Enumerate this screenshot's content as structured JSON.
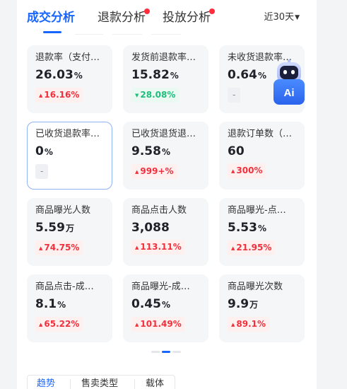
{
  "tabs": [
    {
      "label": "成交分析",
      "active": true,
      "dot": false
    },
    {
      "label": "退款分析",
      "active": false,
      "dot": true
    },
    {
      "label": "投放分析",
      "active": false,
      "dot": true
    }
  ],
  "date_range": {
    "label": "近30天",
    "icon": "caret-down-icon"
  },
  "metrics": [
    {
      "title": "退款率（支付…",
      "value": "26.03",
      "unit": "%",
      "change": "16.16%",
      "trend": "up"
    },
    {
      "title": "发货前退款率…",
      "value": "15.82",
      "unit": "%",
      "change": "28.08%",
      "trend": "down"
    },
    {
      "title": "未收货退款率…",
      "value": "0.64",
      "unit": "%",
      "change": "-",
      "trend": "flat"
    },
    {
      "title": "已收货退款率…",
      "value": "0",
      "unit": "%",
      "change": "-",
      "trend": "flat",
      "selected": true
    },
    {
      "title": "已收货退货退…",
      "value": "9.58",
      "unit": "%",
      "change": "999+%",
      "trend": "up"
    },
    {
      "title": "退款订单数（…",
      "value": "60",
      "unit": "",
      "change": "300%",
      "trend": "up"
    },
    {
      "title": "商品曝光人数",
      "value": "5.59",
      "unit": "万",
      "change": "74.75%",
      "trend": "up"
    },
    {
      "title": "商品点击人数",
      "value": "3,088",
      "unit": "",
      "change": "113.11%",
      "trend": "up"
    },
    {
      "title": "商品曝光-点…",
      "value": "5.53",
      "unit": "%",
      "change": "21.95%",
      "trend": "up"
    },
    {
      "title": "商品点击-成…",
      "value": "8.1",
      "unit": "%",
      "change": "65.22%",
      "trend": "up"
    },
    {
      "title": "商品曝光-成…",
      "value": "0.45",
      "unit": "%",
      "change": "101.49%",
      "trend": "up"
    },
    {
      "title": "商品曝光次数",
      "value": "9.9",
      "unit": "万",
      "change": "89.1%",
      "trend": "up"
    }
  ],
  "ai_assistant": {
    "label": "Ai",
    "icon": "ai-robot-icon"
  },
  "pager": {
    "pages": 3,
    "active": 1
  },
  "bottom_tabs": [
    {
      "label": "趋势",
      "active": true
    },
    {
      "label": "售卖类型",
      "active": false
    },
    {
      "label": "载体",
      "active": false
    }
  ],
  "colors": {
    "accent": "#1966ff",
    "up": "#f0303d",
    "down": "#1fbe7c",
    "dot": "#ff2d3d"
  }
}
